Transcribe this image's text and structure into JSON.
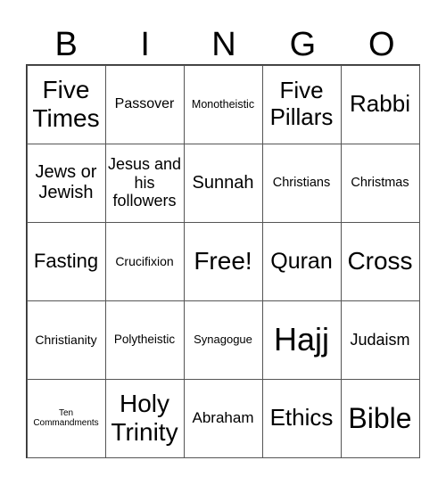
{
  "header": [
    "B",
    "I",
    "N",
    "G",
    "O"
  ],
  "cells": [
    [
      "Five Times",
      "Passover",
      "Monotheistic",
      "Five Pillars",
      "Rabbi"
    ],
    [
      "Jews or Jewish",
      "Jesus and his followers",
      "Sunnah",
      "Christians",
      "Christmas"
    ],
    [
      "Fasting",
      "Crucifixion",
      "Free!",
      "Quran",
      "Cross"
    ],
    [
      "Christianity",
      "Polytheistic",
      "Synagogue",
      "Hajj",
      "Judaism"
    ],
    [
      "Ten Commandments",
      "Holy Trinity",
      "Abraham",
      "Ethics",
      "Bible"
    ]
  ]
}
